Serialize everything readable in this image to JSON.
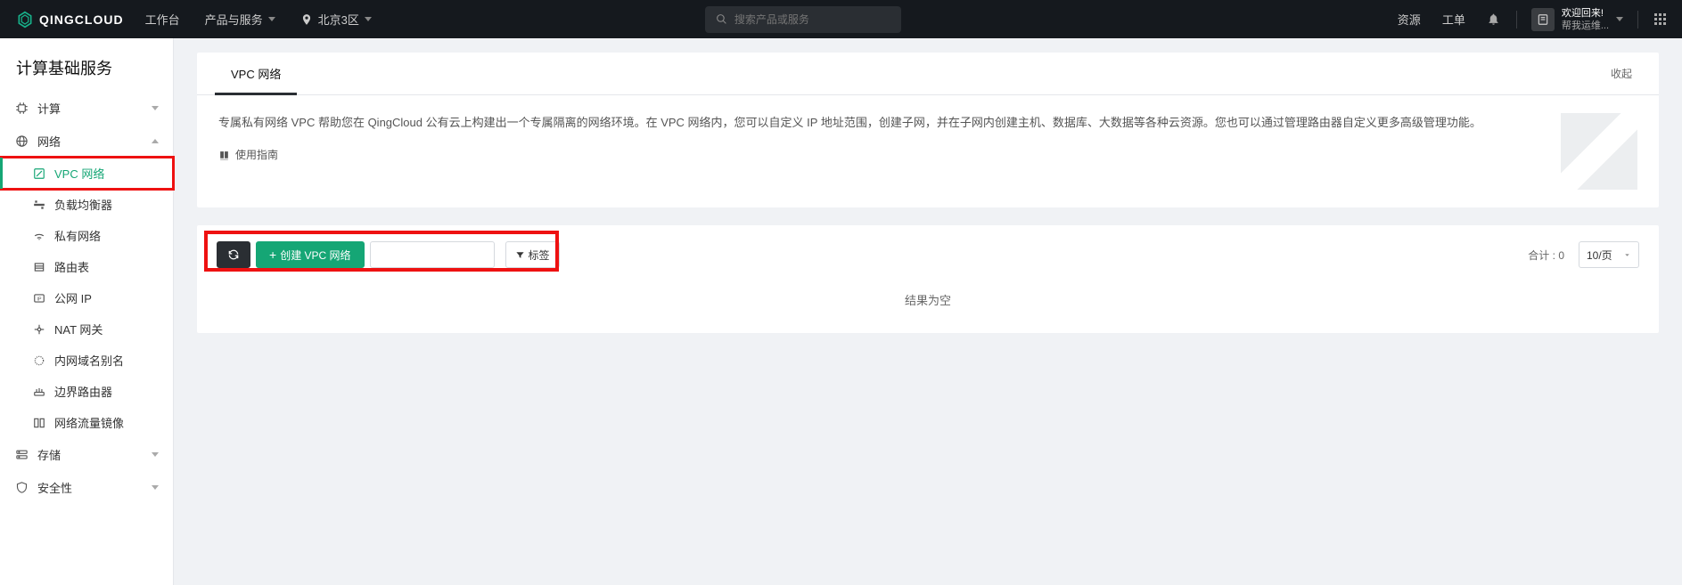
{
  "header": {
    "brand": "QINGCLOUD",
    "workbench": "工作台",
    "products_menu": "产品与服务",
    "region": "北京3区",
    "search_placeholder": "搜索产品或服务",
    "resources": "资源",
    "tickets": "工单",
    "welcome_line1": "欢迎回来!",
    "welcome_line2": "帮我运维..."
  },
  "sidebar": {
    "title": "计算基础服务",
    "groups": {
      "compute": {
        "label": "计算"
      },
      "network": {
        "label": "网络",
        "items": {
          "vpc": "VPC 网络",
          "lb": "负载均衡器",
          "private_net": "私有网络",
          "route_table": "路由表",
          "public_ip": "公网 IP",
          "nat_gateway": "NAT 网关",
          "internal_dns": "内网域名别名",
          "edge_router": "边界路由器",
          "traffic_mirror": "网络流量镜像"
        }
      },
      "storage": {
        "label": "存储"
      },
      "security": {
        "label": "安全性"
      }
    }
  },
  "page": {
    "tab_vpc": "VPC 网络",
    "collapse": "收起",
    "description": "专属私有网络 VPC 帮助您在 QingCloud 公有云上构建出一个专属隔离的网络环境。在 VPC 网络内，您可以自定义 IP 地址范围，创建子网，并在子网内创建主机、数据库、大数据等各种云资源。您也可以通过管理路由器自定义更多高级管理功能。",
    "guide_label": "使用指南",
    "create_btn": "创建 VPC 网络",
    "tag_btn": "标签",
    "total_label": "合计 :",
    "total_count": "0",
    "page_size": "10/页",
    "empty_result": "结果为空"
  }
}
